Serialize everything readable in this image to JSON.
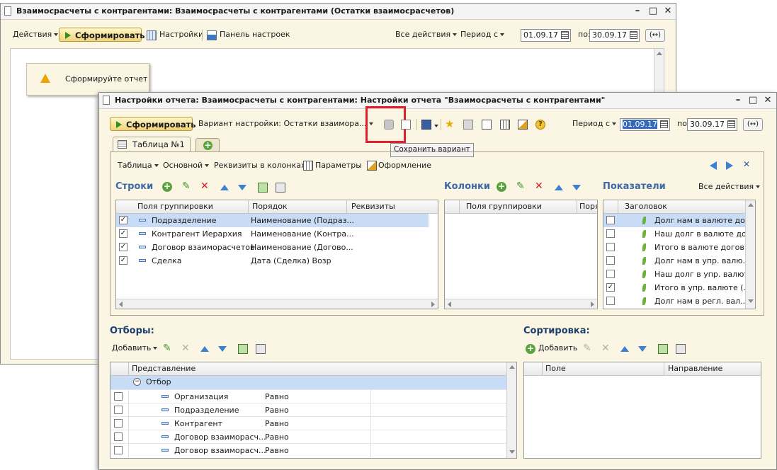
{
  "bg_window": {
    "title": "Взаимосрасчеты с контрагентами: Взаимосрасчеты с контрагентами (Остатки взаимосрасчетов)",
    "toolbar": {
      "actions_label": "Действия",
      "run_label": "Сформировать",
      "settings_label": "Настройки",
      "settings_panel_label": "Панель настроек",
      "all_actions_label": "Все действия",
      "period_label": "Период с",
      "date_from": "01.09.17",
      "to_label": "по:",
      "date_to": "30.09.17",
      "period_btn": "(↔)"
    },
    "notice_text": "Сформируйте отчет"
  },
  "dialog": {
    "title": "Настройки отчета: Взаимосрасчеты с контрагентами: Настройки отчета \"Взаимосрасчеты с контрагентами\"",
    "toolbar": {
      "run_label": "Сформировать",
      "variant_label": "Вариант настройки: Остатки взаимора...",
      "period_label": "Период с",
      "date_from": "01.09.17",
      "to_label": "по:",
      "date_to": "30.09.17",
      "period_btn": "(↔)",
      "tooltip": "Сохранить вариант",
      "highlight_color": "#e0202a"
    },
    "tabs": {
      "active": "Таблица №1"
    },
    "subtoolbar": {
      "table": "Таблица",
      "main": "Основной",
      "props_in_columns": "Реквизиты в колонках",
      "parameters": "Параметры",
      "design": "Оформление"
    },
    "rows_section": {
      "title": "Строки",
      "headers": [
        "Поля группировки",
        "Порядок",
        "Реквизиты"
      ],
      "items": [
        {
          "field": "Подразделение",
          "order": "Наименование (Подраз...",
          "checked": true,
          "selected": true
        },
        {
          "field": "Контрагент Иерархия",
          "order": "Наименование (Контра...",
          "checked": true,
          "selected": false
        },
        {
          "field": "Договор взаиморасчетов",
          "order": "Наименование (Догово...",
          "checked": true,
          "selected": false
        },
        {
          "field": "Сделка",
          "order": "Дата (Сделка) Возр",
          "checked": true,
          "selected": false
        }
      ]
    },
    "columns_section": {
      "title": "Колонки",
      "headers": [
        "Поля группировки",
        "Поря"
      ]
    },
    "indicators_section": {
      "title": "Показатели",
      "all_actions": "Все действия",
      "header": "Заголовок",
      "items": [
        {
          "label": "Долг нам в валюте до...",
          "checked": false,
          "selected": true
        },
        {
          "label": "Наш долг в валюте до...",
          "checked": false,
          "selected": false
        },
        {
          "label": "Итого в валюте догов...",
          "checked": false,
          "selected": false
        },
        {
          "label": "Долг нам в упр. валю...",
          "checked": false,
          "selected": false
        },
        {
          "label": "Наш долг в упр. валют...",
          "checked": false,
          "selected": false
        },
        {
          "label": "Итого в упр. валюте (...",
          "checked": true,
          "selected": false
        },
        {
          "label": "Долг нам в регл. вал...",
          "checked": false,
          "selected": false
        }
      ]
    },
    "filters_section": {
      "title": "Отборы:",
      "add_label": "Добавить",
      "header": "Представление",
      "group_label": "Отбор",
      "items": [
        {
          "field": "Организация",
          "condition": "Равно"
        },
        {
          "field": "Подразделение",
          "condition": "Равно"
        },
        {
          "field": "Контрагент",
          "condition": "Равно"
        },
        {
          "field": "Договор взаиморасч...",
          "condition": "Равно"
        },
        {
          "field": "Договор взаиморасч...",
          "condition": "Равно"
        }
      ]
    },
    "sort_section": {
      "title": "Сортировка:",
      "add_label": "Добавить",
      "headers": [
        "Поле",
        "Направление"
      ]
    }
  }
}
